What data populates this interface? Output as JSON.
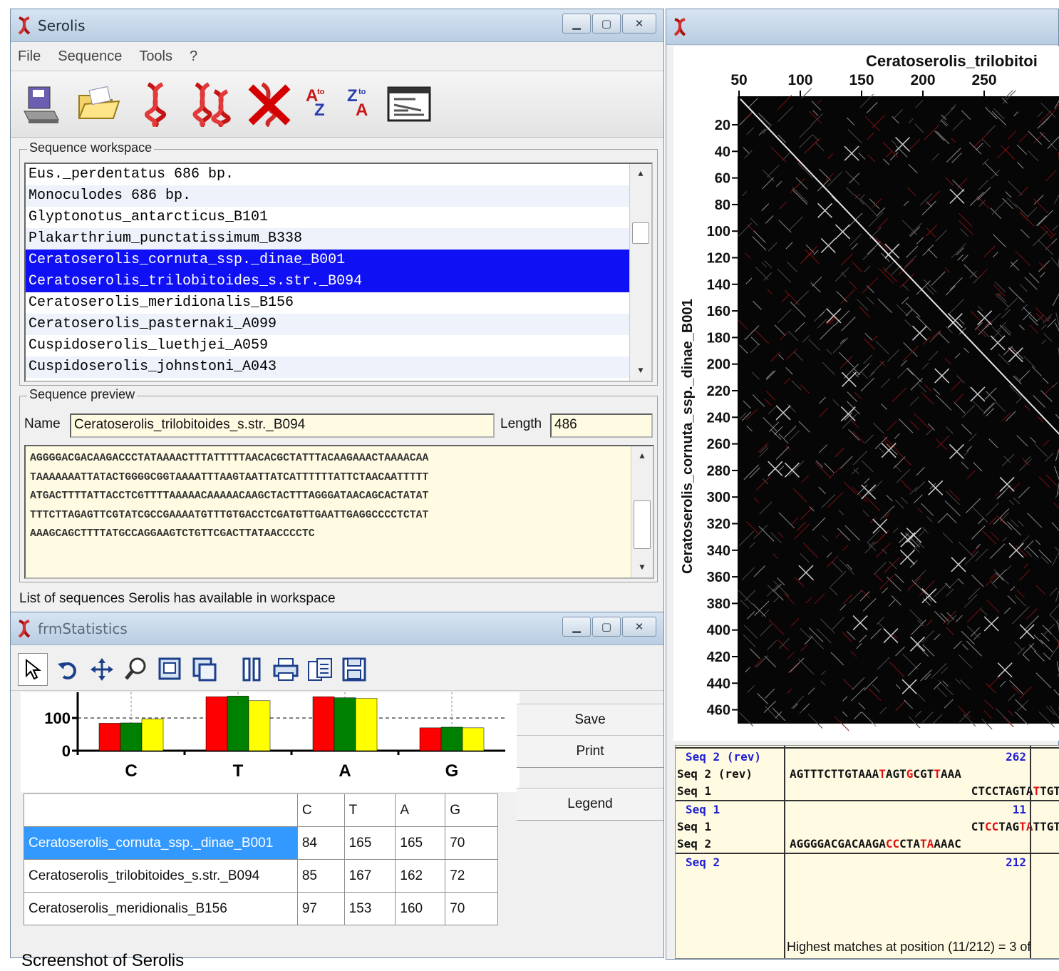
{
  "serolis_window": {
    "title": "Serolis",
    "menu": [
      "File",
      "Sequence",
      "Tools",
      "?"
    ],
    "toolbar_icons": [
      "save-disk-icon",
      "open-folder-icon",
      "dna-icon",
      "dna-double-icon",
      "dna-delete-icon",
      "sort-a-z-icon",
      "sort-z-a-icon",
      "console-window-icon"
    ],
    "sort_az": {
      "top": "A",
      "bottom": "Z",
      "mid": "to"
    },
    "sort_za": {
      "top": "Z",
      "bottom": "A",
      "mid": "to"
    },
    "workspace": {
      "label": "Sequence workspace",
      "rows": [
        "Eus._perdentatus 686 bp.",
        "Monoculodes 686 bp.",
        "Glyptonotus_antarcticus_B101",
        "Plakarthrium_punctatissimum_B338",
        "Ceratoserolis_cornuta_ssp._dinae_B001",
        "Ceratoserolis_trilobitoides_s.str._B094",
        "Ceratoserolis_meridionalis_B156",
        "Ceratoserolis_pasternaki_A099",
        "Cuspidoserolis_luethjei_A059",
        "Cuspidoserolis_johnstoni_A043"
      ]
    },
    "preview": {
      "label": "Sequence preview",
      "name_label": "Name",
      "name_value": "Ceratoserolis_trilobitoides_s.str._B094",
      "length_label": "Length",
      "length_value": "486",
      "sequence_lines": [
        "AGGGGACGACAAGACCCTATAAAACTTTATTTTTAACACGCTATTTACAAGAAACTAAAACAA",
        "TAAAAAAATTATACTGGGGCGGTAAAATTTAAGTAATTATCATTTTTTATTCTAACAATTTTT",
        "ATGACTTTTATTACCTCGTTTTAAAAACAAAAACAAGCTACTTTAGGGATAACAGCACTATAT",
        "TTTCTTAGAGTTCGTATCGCCGAAAATGTTTGTGACCTCGATGTTGAATTGAGGCCCCTCTAT",
        "AAAGCAGCTTTTATGCCAGGAAGTCTGTTCGACTTATAACCCCTC"
      ]
    },
    "status": "List of sequences Serolis has available in workspace"
  },
  "stats_window": {
    "title": "frmStatistics",
    "toolbar_icons": [
      "pointer-icon",
      "rotate-icon",
      "move-icon",
      "zoom-icon",
      "export-image-icon",
      "copy-image-icon",
      "settings-icon",
      "print-icon",
      "copy-icon",
      "save-icon"
    ],
    "buttons": {
      "save": "Save",
      "print": "Print",
      "legend": "Legend"
    },
    "table": {
      "headers": [
        "",
        "C",
        "T",
        "A",
        "G"
      ],
      "rows": [
        {
          "name": "Ceratoserolis_cornuta_ssp._dinae_B001",
          "C": "84",
          "T": "165",
          "A": "165",
          "G": "70"
        },
        {
          "name": "Ceratoserolis_trilobitoides_s.str._B094",
          "C": "85",
          "T": "167",
          "A": "162",
          "G": "72"
        },
        {
          "name": "Ceratoserolis_meridionalis_B156",
          "C": "97",
          "T": "153",
          "A": "160",
          "G": "70"
        }
      ]
    }
  },
  "chart_data": {
    "type": "bar",
    "categories": [
      "C",
      "T",
      "A",
      "G"
    ],
    "series": [
      {
        "values": [
          84,
          165,
          165,
          70
        ],
        "color": "#ff0000"
      },
      {
        "values": [
          85,
          167,
          162,
          72
        ],
        "color": "#008000"
      },
      {
        "values": [
          97,
          153,
          160,
          70
        ],
        "color": "#ffff00"
      }
    ],
    "ytick_labels": [
      "0",
      "100"
    ],
    "ylim": [
      0,
      170
    ],
    "ref_line": 100,
    "grid": false
  },
  "dotplot_window": {
    "x_title": "Ceratoserolis_trilobitoi",
    "y_title": "Ceratoserolis_cornuta_ssp._dinae_B001",
    "x_ticks": [
      "50",
      "100",
      "150",
      "200",
      "250"
    ],
    "y_ticks": [
      "20",
      "40",
      "60",
      "80",
      "100",
      "120",
      "140",
      "160",
      "180",
      "200",
      "220",
      "240",
      "260",
      "280",
      "300",
      "320",
      "340",
      "360",
      "380",
      "400",
      "420",
      "440",
      "460"
    ],
    "alignment": {
      "rows": [
        {
          "label": "Seq 2 (rev)",
          "value": "262",
          "label_color": "#2020d0",
          "header": true
        },
        {
          "label": "Seq 2 (rev)",
          "seq": [
            [
              "AGTTTCTTGTAAA",
              "k"
            ],
            [
              "T",
              "r"
            ],
            [
              "AGT",
              "k"
            ],
            [
              "G",
              "r"
            ],
            [
              "CGT",
              "k"
            ],
            [
              "T",
              "r"
            ],
            [
              "AAA",
              "k"
            ]
          ]
        },
        {
          "label": "Seq 1",
          "seq": [
            [
              "CTCCTAGTA",
              "k"
            ],
            [
              "T",
              "r"
            ],
            [
              "TGT",
              "k"
            ]
          ],
          "align": "right"
        },
        {
          "label": "Seq 1",
          "value": "11",
          "label_color": "#2020d0",
          "header": true
        },
        {
          "label": "Seq 1",
          "seq": [
            [
              "CT",
              "k"
            ],
            [
              "CC",
              "r"
            ],
            [
              "TAG",
              "k"
            ],
            [
              "TA",
              "r"
            ],
            [
              "T",
              "k"
            ],
            [
              "TGT",
              "k"
            ]
          ],
          "align": "right"
        },
        {
          "label": "Seq 2",
          "seq": [
            [
              "AGGGGACGACAAGA",
              "k"
            ],
            [
              "CC",
              "r"
            ],
            [
              "CTA",
              "k"
            ],
            [
              "TA",
              "r"
            ],
            [
              "AAAC",
              "k"
            ]
          ]
        },
        {
          "label": "Seq 2",
          "value": "212",
          "label_color": "#2020d0",
          "header": true
        }
      ],
      "footer": "Highest matches at position (11/212) = 3 of"
    }
  },
  "caption": "Screenshot of Serolis"
}
